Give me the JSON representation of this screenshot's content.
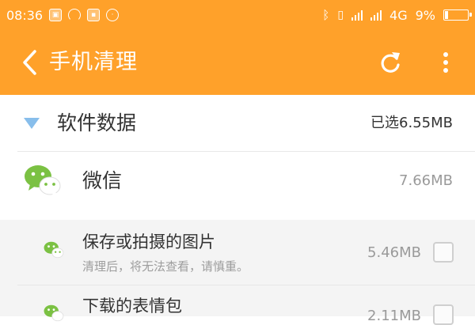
{
  "status_bar": {
    "time": "08:36",
    "network": "4G",
    "battery": "9%",
    "icons": [
      "scan-icon",
      "headset-icon",
      "app-badge-icon",
      "clock-icon",
      "bluetooth-icon",
      "vibrate-icon",
      "signal-icon",
      "signal-icon",
      "battery-icon"
    ]
  },
  "header": {
    "title": "手机清理",
    "back_icon": "back-arrow-icon",
    "refresh_icon": "refresh-icon",
    "more_icon": "more-vertical-icon"
  },
  "section": {
    "title": "软件数据",
    "selected": "已选6.55MB"
  },
  "app": {
    "name": "微信",
    "size": "7.66MB"
  },
  "items": [
    {
      "title": "保存或拍摄的图片",
      "desc": "清理后，将无法查看，请慎重。",
      "size": "5.46MB",
      "checked": false
    },
    {
      "title": "下载的表情包",
      "desc": "",
      "size": "2.11MB",
      "checked": false
    }
  ],
  "colors": {
    "accent": "#FFA12A",
    "triangle": "#88BEEB",
    "wechat_green": "#7BC143",
    "sub_background": "#F4F4F4"
  }
}
